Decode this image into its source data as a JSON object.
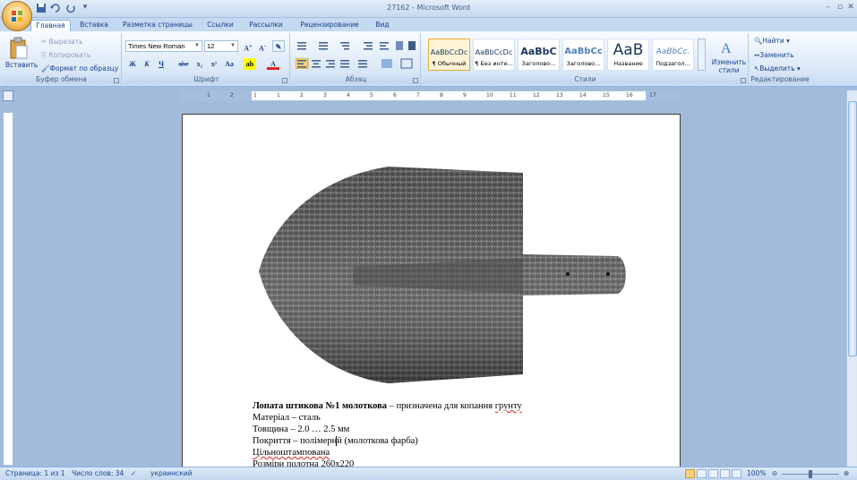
{
  "window": {
    "title": "27162 - Microsoft Word"
  },
  "tabs": [
    {
      "label": "Главная",
      "active": true
    },
    {
      "label": "Вставка"
    },
    {
      "label": "Разметка страницы"
    },
    {
      "label": "Ссылки"
    },
    {
      "label": "Рассылки"
    },
    {
      "label": "Рецензирование"
    },
    {
      "label": "Вид"
    }
  ],
  "ribbon": {
    "clipboard": {
      "paste": "Вставить",
      "cut": "Вырезать",
      "copy": "Копировать",
      "format_painter": "Формат по образцу",
      "label": "Буфер обмена"
    },
    "font": {
      "name": "Times New Roman",
      "size": "12",
      "bold": "Ж",
      "italic": "К",
      "underline": "Ч",
      "strike": "abe",
      "subscript": "x₂",
      "superscript": "x²",
      "case": "Aa",
      "label": "Шрифт"
    },
    "paragraph": {
      "label": "Абзац"
    },
    "styles": {
      "items": [
        {
          "sample": "AaBbCcDc",
          "name": "¶ Обычный"
        },
        {
          "sample": "AaBbCcDc",
          "name": "¶ Без инте..."
        },
        {
          "sample": "AaBbC",
          "name": "Заголово..."
        },
        {
          "sample": "AaBbCc",
          "name": "Заголово..."
        },
        {
          "sample": "AaB",
          "name": "Название"
        },
        {
          "sample": "AaBbCc.",
          "name": "Подзагол..."
        }
      ],
      "change_styles": "Изменить стили",
      "label": "Стили"
    },
    "editing": {
      "find": "Найти",
      "replace": "Заменить",
      "select": "Выделить",
      "label": "Редактирование"
    }
  },
  "ruler": {
    "numbers": [
      "1",
      "2",
      "1",
      "1",
      "2",
      "3",
      "4",
      "5",
      "6",
      "7",
      "8",
      "9",
      "10",
      "11",
      "12",
      "13",
      "14",
      "15",
      "16",
      "17"
    ]
  },
  "document": {
    "title_bold": "Лопата штикова №1 молоткова",
    "title_rest": " – призначена для копання ",
    "title_spell": "грунту",
    "line2": "Матеріал – сталь",
    "line3": "Товщина – 2.0 … 2.5 мм",
    "line4_a": "Покриття – полімерн",
    "line4_b": "й (молоткова фарба)",
    "line5": "Цільноштампована",
    "line6": "Розміри полотна 260х220"
  },
  "status": {
    "page": "Страница: 1 из 1",
    "words": "Число слов: 34",
    "language": "украинский",
    "zoom": "100%"
  },
  "colors": {
    "accent": "#15428b",
    "ribbon_bg": "#dbe8f7",
    "app_bg": "#a3bbdb"
  }
}
